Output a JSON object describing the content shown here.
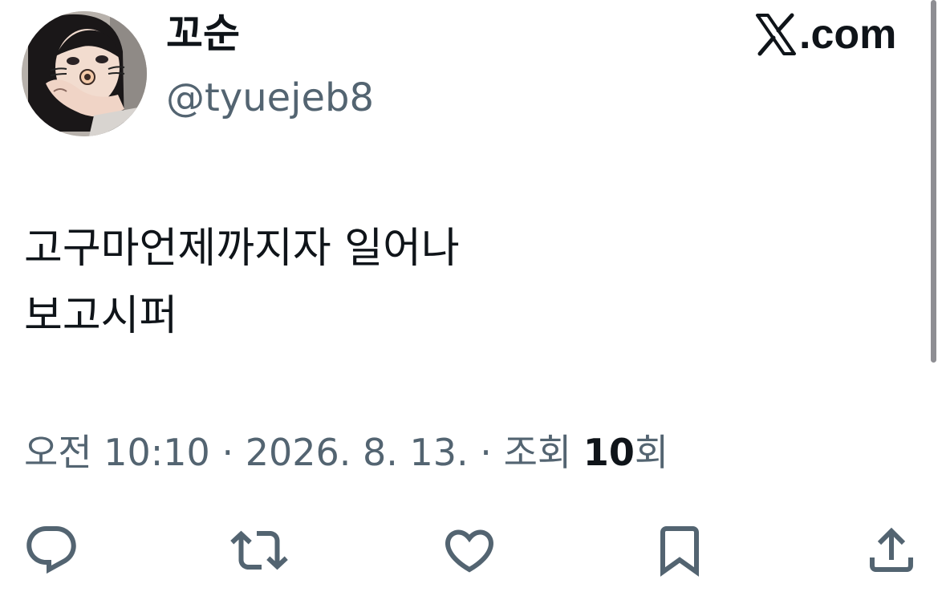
{
  "tweet": {
    "display_name": "꼬순",
    "handle": "@tyuejeb8",
    "site": "X.com",
    "text_lines": [
      "고구마언제까지자 일어나",
      "보고시퍼"
    ],
    "time": "오전 10:10",
    "separator": " · ",
    "date": "2026. 8. 13.",
    "views_label": "조회",
    "views_count": "10",
    "views_suffix": "회"
  },
  "icons": {
    "reply": "reply-icon",
    "repost": "repost-icon",
    "like": "heart-icon",
    "bookmark": "bookmark-icon",
    "share": "share-icon"
  },
  "colors": {
    "text": "#0f1419",
    "secondary": "#536471",
    "background": "#ffffff"
  }
}
